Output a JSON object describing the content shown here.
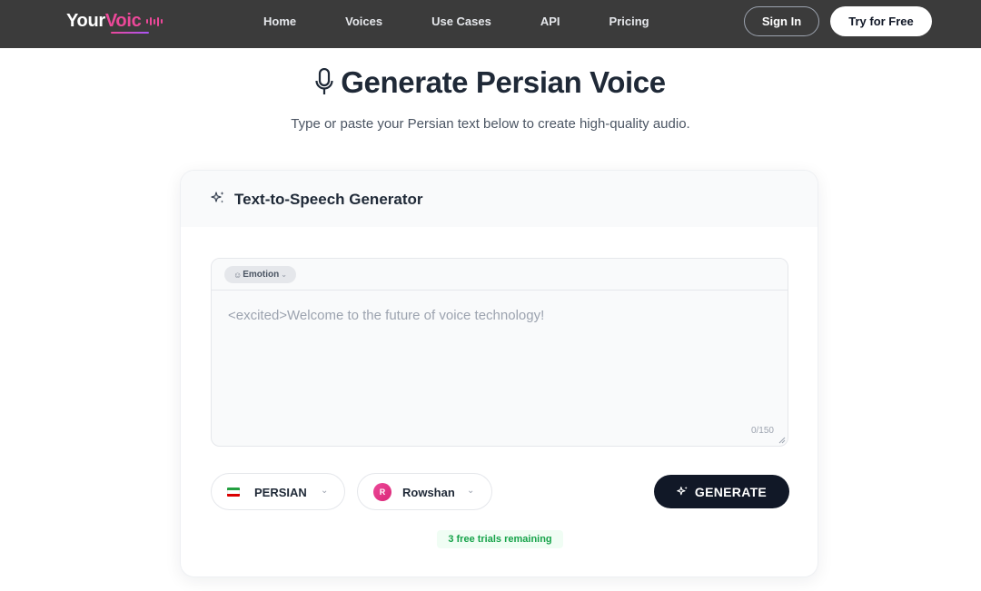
{
  "brand": {
    "part1": "Your",
    "part2": "Voic",
    "accent_color": "#ec4899"
  },
  "nav": {
    "links": [
      "Home",
      "Voices",
      "Use Cases",
      "API",
      "Pricing"
    ],
    "signin_label": "Sign In",
    "try_label": "Try for Free"
  },
  "hero": {
    "title": "Generate Persian Voice",
    "subtitle": "Type or paste your Persian text below to create high-quality audio.",
    "icon": "microphone-icon"
  },
  "card": {
    "title": "Text-to-Speech Generator",
    "icon": "sparkles-icon",
    "emotion_label": "Emotion",
    "placeholder": "<excited>Welcome to the future of voice technology!",
    "counter": "0/150",
    "language": {
      "label": "PERSIAN",
      "flag_colors": [
        "#239f40",
        "#ffffff",
        "#da0000"
      ]
    },
    "voice": {
      "label": "Rowshan",
      "avatar_initial": "R"
    },
    "generate_label": "GENERATE",
    "trials_text": "3 free trials remaining"
  }
}
